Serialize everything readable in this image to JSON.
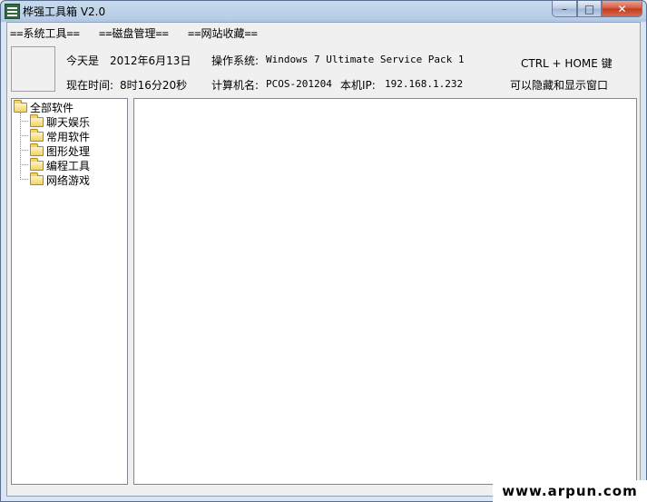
{
  "window": {
    "title": "桦强工具箱 V2.0",
    "minimize": "–",
    "maximize": "□",
    "close": "✕"
  },
  "menu": [
    "==系统工具==",
    "==磁盘管理==",
    "==网站收藏=="
  ],
  "info": {
    "today_label": "今天是",
    "today_value": "2012年6月13日",
    "time_label": "现在时间:",
    "time_value": "8时16分20秒",
    "os_label": "操作系统:",
    "os_value": "Windows 7 Ultimate  Service Pack 1",
    "pc_label": "计算机名:",
    "pc_value": "PCOS-201204",
    "ip_label": "本机IP:",
    "ip_value": "192.168.1.232",
    "hint_line1": "CTRL + HOME 键",
    "hint_line2": "可以隐藏和显示窗口"
  },
  "tree": {
    "root": "全部软件",
    "children": [
      "聊天娱乐",
      "常用软件",
      "图形处理",
      "编程工具",
      "网络游戏"
    ]
  },
  "watermark": "www.arpun.com",
  "colors": {
    "title_bar": "#b7cde5",
    "close_button": "#c23b1f",
    "folder": "#f3d36b"
  }
}
